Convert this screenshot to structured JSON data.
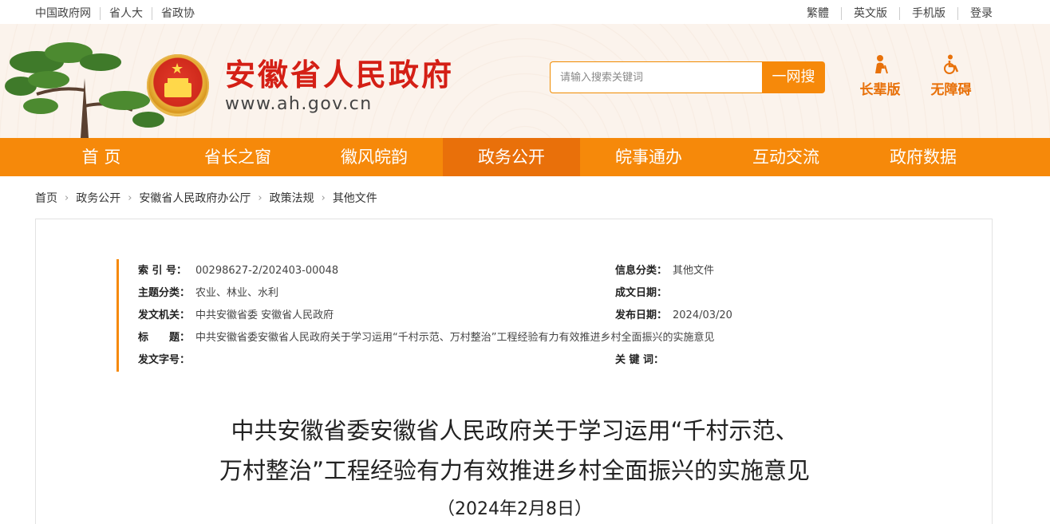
{
  "topbar": {
    "left_links": [
      "中国政府网",
      "省人大",
      "省政协"
    ],
    "right_links": [
      "繁體",
      "英文版",
      "手机版",
      "登录"
    ]
  },
  "header": {
    "site_title": "安徽省人民政府",
    "site_url": "www.ah.gov.cn",
    "search_placeholder": "请输入搜索关键词",
    "search_button": "一网搜",
    "mode_elder": "长辈版",
    "mode_accessible": "无障碍"
  },
  "nav": {
    "items": [
      "首 页",
      "省长之窗",
      "徽风皖韵",
      "政务公开",
      "皖事通办",
      "互动交流",
      "政府数据"
    ],
    "active": "政务公开"
  },
  "breadcrumb": [
    "首页",
    "政务公开",
    "安徽省人民政府办公厅",
    "政策法规",
    "其他文件"
  ],
  "meta": {
    "index_label": "索 引 号：",
    "index_value": "00298627-2/202403-00048",
    "category_label": "信息分类：",
    "category_value": "其他文件",
    "topic_label": "主题分类：",
    "topic_value": "农业、林业、水利",
    "written_date_label": "成文日期：",
    "written_date_value": "",
    "issuer_label": "发文机关：",
    "issuer_value": "中共安徽省委 安徽省人民政府",
    "publish_date_label": "发布日期：",
    "publish_date_value": "2024/03/20",
    "title_label": "标　　题：",
    "title_value": "中共安徽省委安徽省人民政府关于学习运用“千村示范、万村整治”工程经验有力有效推进乡村全面振兴的实施意见",
    "doc_number_label": "发文字号：",
    "doc_number_value": "",
    "keywords_label": "关 键 词：",
    "keywords_value": ""
  },
  "document": {
    "title_line1": "中共安徽省委安徽省人民政府关于学习运用“千村示范、",
    "title_line2": "万村整治”工程经验有力有效推进乡村全面振兴的实施意见",
    "date": "（2024年2月8日）"
  },
  "colors": {
    "accent": "#f6890a",
    "nav_active": "#e9700a",
    "title_red": "#d41f15"
  }
}
